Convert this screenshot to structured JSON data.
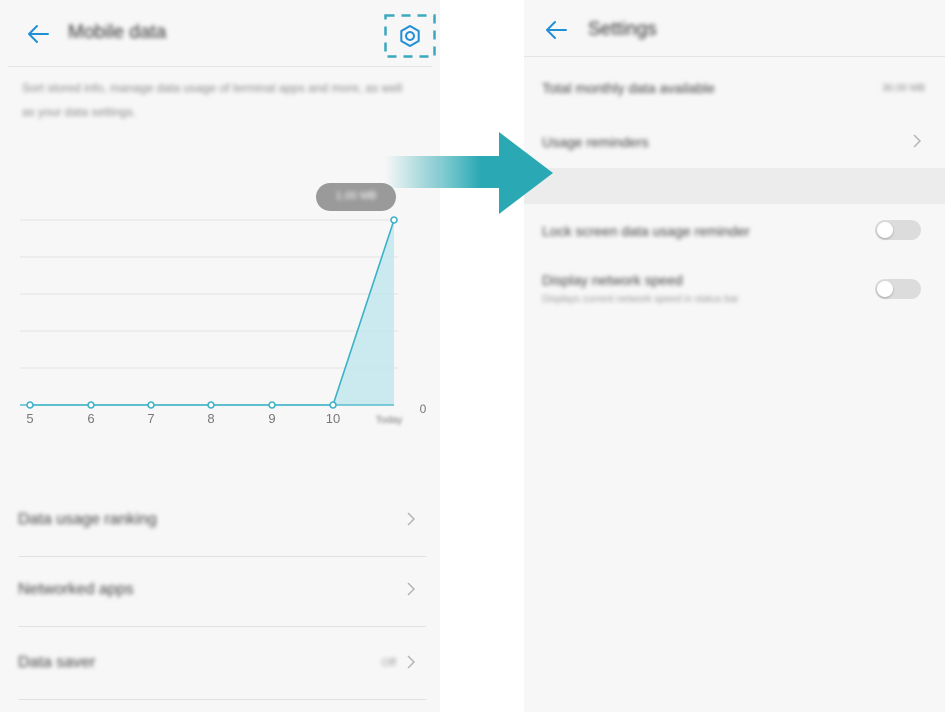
{
  "left_screen": {
    "title": "Mobile data",
    "description": "Sort stored info, manage data usage of terminal apps and more, as well as your data settings.",
    "chart_data": {
      "type": "area",
      "x": [
        "5",
        "6",
        "7",
        "8",
        "9",
        "10",
        "Today"
      ],
      "values": [
        0,
        0,
        0,
        0,
        0,
        0,
        1
      ],
      "tooltip": "1.00 MB",
      "y_tick": "0",
      "grid": true
    },
    "menu": [
      {
        "label": "Data usage ranking",
        "value": ""
      },
      {
        "label": "Networked apps",
        "value": ""
      },
      {
        "label": "Data saver",
        "value": "Off"
      }
    ]
  },
  "right_screen": {
    "title": "Settings",
    "items": [
      {
        "label": "Total monthly data available",
        "value": "30.00 MB"
      },
      {
        "label": "Usage reminders"
      }
    ],
    "toggles": [
      {
        "label": "Lock screen data usage reminder",
        "sub": "",
        "on": false
      },
      {
        "label": "Display network speed",
        "sub": "Displays current network speed in status bar",
        "on": false
      }
    ]
  },
  "colors": {
    "accent": "#3bb2c6",
    "arrow_dark": "#2aa8b3",
    "background": "#f7f7f7",
    "highlight_box": "#3aa9bd"
  }
}
